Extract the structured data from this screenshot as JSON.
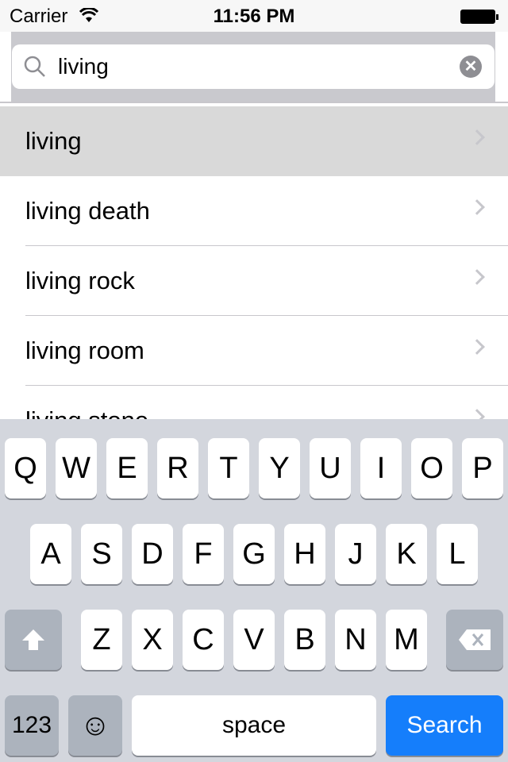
{
  "status": {
    "carrier": "Carrier",
    "time": "11:56 PM",
    "battery_percent": 100
  },
  "search": {
    "query": "living"
  },
  "results": [
    {
      "label": "living",
      "selected": true
    },
    {
      "label": "living death"
    },
    {
      "label": "living rock"
    },
    {
      "label": "living room"
    },
    {
      "label": "living stone"
    }
  ],
  "keyboard": {
    "row1": [
      "Q",
      "W",
      "E",
      "R",
      "T",
      "Y",
      "U",
      "I",
      "O",
      "P"
    ],
    "row2": [
      "A",
      "S",
      "D",
      "F",
      "G",
      "H",
      "J",
      "K",
      "L"
    ],
    "row3": [
      "Z",
      "X",
      "C",
      "V",
      "B",
      "N",
      "M"
    ],
    "numbers": "123",
    "emoji": "☺",
    "space": "space",
    "search": "Search"
  },
  "colors": {
    "accent": "#157efb",
    "searchbar": "#c9c9ce",
    "keyboard": "#d3d6dd"
  }
}
